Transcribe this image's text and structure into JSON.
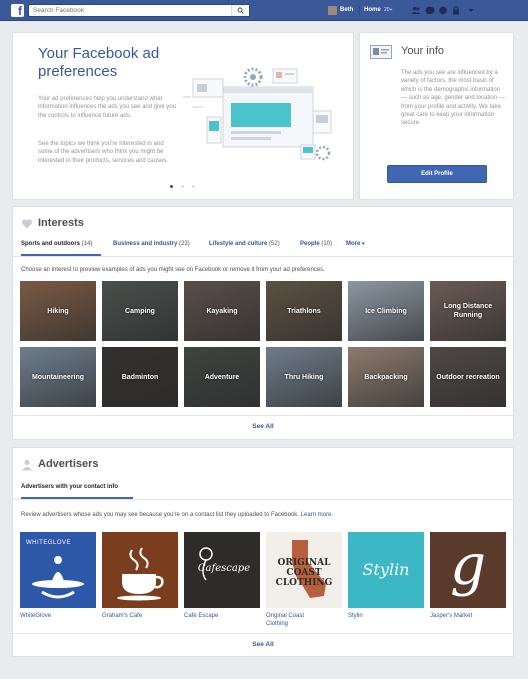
{
  "topbar": {
    "search_placeholder": "Search Facebook",
    "logo_letter": "f",
    "user_name": "Beth",
    "home_label": "Home",
    "home_count": "20+",
    "icons": [
      "friends-icon",
      "messages-icon",
      "notifications-icon",
      "privacy-icon",
      "settings-icon"
    ]
  },
  "hero": {
    "title": "Your Facebook ad preferences",
    "paragraph_1": "Your ad preferences help you understand what information influences the ads you see and give you the controls to influence future ads.",
    "paragraph_2": "See the topics we think you're interested in and some of the advertisers who think you might be interested in their products, services and causes.",
    "carousel_pages": 3,
    "carousel_active": 1,
    "accent_color": "#4ac3c9"
  },
  "info": {
    "title": "Your info",
    "paragraph": "The ads you see are influenced by a variety of factors, the most basic of which is the demographic information — such as age, gender and location — from your profile and activity. We take great care to keep your information secure.",
    "button_label": "Edit Profile",
    "button_color": "#4267b2"
  },
  "interests": {
    "title": "Interests",
    "tabs": [
      {
        "label": "Sports and outdoors",
        "count": "(14)",
        "active": true
      },
      {
        "label": "Business and industry",
        "count": "(23)",
        "active": false
      },
      {
        "label": "Lifestyle and culture",
        "count": "(52)",
        "active": false
      },
      {
        "label": "People",
        "count": "(10)",
        "active": false
      },
      {
        "label": "More",
        "count": "",
        "active": false
      }
    ],
    "description": "Choose an interest to preview examples of ads you might see on Facebook or remove it from your ad preferences.",
    "tiles": [
      {
        "label": "Hiking",
        "color": "#7a5a44"
      },
      {
        "label": "Camping",
        "color": "#4a4f4c"
      },
      {
        "label": "Kayaking",
        "color": "#5a4e49"
      },
      {
        "label": "Triathlons",
        "color": "#5c5142"
      },
      {
        "label": "Ice Climbing",
        "color": "#8c98a4"
      },
      {
        "label": "Long Distance Running",
        "color": "#6b5a54"
      },
      {
        "label": "Mountaineering",
        "color": "#6e7e8e"
      },
      {
        "label": "Badminton",
        "color": "#33312e"
      },
      {
        "label": "Adventure",
        "color": "#3e4440"
      },
      {
        "label": "Thru Hiking",
        "color": "#6e7c8a"
      },
      {
        "label": "Backpacking",
        "color": "#8c7a6e"
      },
      {
        "label": "Outdoor recreation",
        "color": "#4e4846"
      }
    ],
    "see_all": "See All"
  },
  "advertisers": {
    "title": "Advertisers",
    "tab_label": "Advertisers with your contact info",
    "description": "Review advertisers whose ads you may see because you're on a contact list they uploaded to Facebook.",
    "learn_more": "Learn more.",
    "items": [
      {
        "name": "WhiteGlove",
        "logo_text": "WHITEGLOVE",
        "color": "#2d57a8"
      },
      {
        "name": "Graham's Cafe",
        "logo_text": "",
        "color": "#7a3e1e"
      },
      {
        "name": "Cafe Escape",
        "logo_text": "Cafescape",
        "color": "#2e2c2a"
      },
      {
        "name": "Original Coast Clothing",
        "logo_text": "ORIGINAL COAST CLOTHING",
        "color": "#f2efe9"
      },
      {
        "name": "Stylin",
        "logo_text": "Stylin",
        "color": "#3cb7c5"
      },
      {
        "name": "Jasper's Market",
        "logo_text": "g",
        "color": "#5a3a2a"
      }
    ],
    "see_all": "See All"
  }
}
